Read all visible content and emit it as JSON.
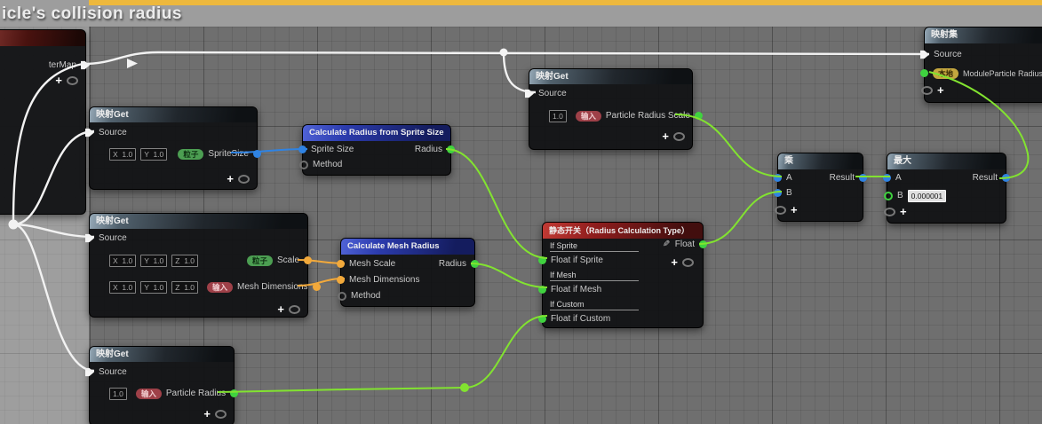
{
  "comment": {
    "title": "icle's collision radius"
  },
  "colors": {
    "comment_selected_border": "#edb83d",
    "graph_background": "#6f6f6f",
    "wire_parameter_map": "#f2f2f2",
    "wire_float": "#82e330",
    "wire_vector2d": "#2f83e3",
    "wire_vector3": "#f2a93b",
    "pin_green": "#3fd23f",
    "pin_blue": "#2f83e3",
    "pin_yellow": "#f2a93b",
    "header_function": "#3c50c0",
    "header_switch": "#8f1d1d"
  },
  "nodes": {
    "param_node": {
      "output": "terMap"
    },
    "map_get_1": {
      "title": "映射Get",
      "source": "Source",
      "fields": [
        "X  1.0",
        "Y  1.0"
      ],
      "badge": "粒子",
      "output": "SpriteSize"
    },
    "calc_sprite": {
      "title": "Calculate Radius from Sprite Size",
      "input_1": "Sprite Size",
      "input_2": "Method",
      "output": "Radius"
    },
    "map_get_2": {
      "title": "映射Get",
      "source": "Source",
      "row1": {
        "fields": [
          "X  1.0",
          "Y  1.0",
          "Z  1.0"
        ],
        "badge": "粒子",
        "label": "Scale"
      },
      "row2": {
        "fields": [
          "X  1.0",
          "Y  1.0",
          "Z  1.0"
        ],
        "badge": "输入",
        "label": "Mesh Dimensions"
      }
    },
    "calc_mesh": {
      "title": "Calculate Mesh Radius",
      "input_1": "Mesh Scale",
      "input_2": "Mesh Dimensions",
      "input_3": "Method",
      "output": "Radius"
    },
    "map_get_3": {
      "title": "映射Get",
      "source": "Source",
      "field": "1.0",
      "badge": "输入",
      "output": "Particle Radius"
    },
    "map_get_4": {
      "title": "映射Get",
      "source": "Source",
      "field": "1.0",
      "badge": "输入",
      "output": "Particle Radius Scale"
    },
    "static_switch": {
      "title": "静态开关（Radius Calculation Type）",
      "sec1": "If Sprite",
      "pin1": "Float if Sprite",
      "sec2": "If Mesh",
      "pin2": "Float if Mesh",
      "sec3": "If Custom",
      "pin3": "Float if Custom",
      "output": "Float"
    },
    "multiply": {
      "title": "乘",
      "input_a": "A",
      "input_b": "B",
      "output": "Result"
    },
    "max": {
      "title": "最大",
      "input_a": "A",
      "input_b": "B",
      "value_b": "0.000001",
      "output": "Result"
    },
    "map_set": {
      "title": "映射集",
      "source": "Source",
      "badge": "本地",
      "input": "ModuleParticle Radius"
    }
  }
}
